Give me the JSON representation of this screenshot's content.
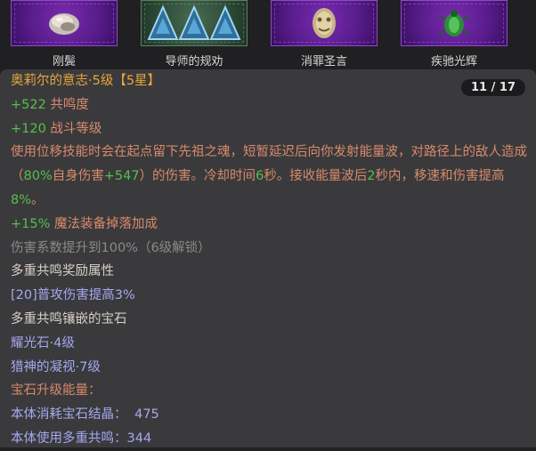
{
  "gems": [
    {
      "label": "刚鬓",
      "icon": "pearl-shell-icon",
      "tile": "purple"
    },
    {
      "label": "导师的规劝",
      "icon": "triple-triangle-icon",
      "tile": "green"
    },
    {
      "label": "消罪圣言",
      "icon": "golden-mask-icon",
      "tile": "purple"
    },
    {
      "label": "疾驰光辉",
      "icon": "green-beetle-icon",
      "tile": "purple"
    }
  ],
  "panel": {
    "counter": "11 / 17",
    "title": "奥莉尔的意志·5级【5星】",
    "stat1": {
      "value": "+522",
      "name": " 共鸣度"
    },
    "stat2": {
      "value": "+120",
      "name": " 战斗等级"
    },
    "desc": {
      "p1": "使用位移技能时会在起点留下先祖之魂，短暂延迟后向你发射能量波，对路径上的敌人造成（",
      "pct": "80%",
      "p2": "自身伤害",
      "plus": "+547",
      "p3": "）的伤害。冷却时间",
      "cd": "6",
      "p4": "秒。接收能量波后",
      "dur": "2",
      "p5": "秒内，移速和伤害提高",
      "buff": "8%",
      "p6": "。"
    },
    "stat3": {
      "value": "+15%",
      "name": " 魔法装备掉落加成"
    },
    "locked": "伤害系数提升到100%（6级解锁）",
    "resonance_header": "多重共鸣奖励属性",
    "resonance_bonus": "[20]普攻伤害提高3%",
    "socket_header": "多重共鸣镶嵌的宝石",
    "socket1": "耀光石·4级",
    "socket2": "猎神的凝视·7级",
    "energy_header": "宝石升级能量：",
    "energy1_label": "本体消耗宝石结晶：",
    "energy1_value": "475",
    "energy2_label": "本体使用多重共鸣：",
    "energy2_value": "344"
  },
  "colors": {
    "title": "#e9a53c",
    "green": "#55c04a",
    "desc": "#d98a6b",
    "gray": "#8a8a8a",
    "blue": "#a7a7f0"
  }
}
